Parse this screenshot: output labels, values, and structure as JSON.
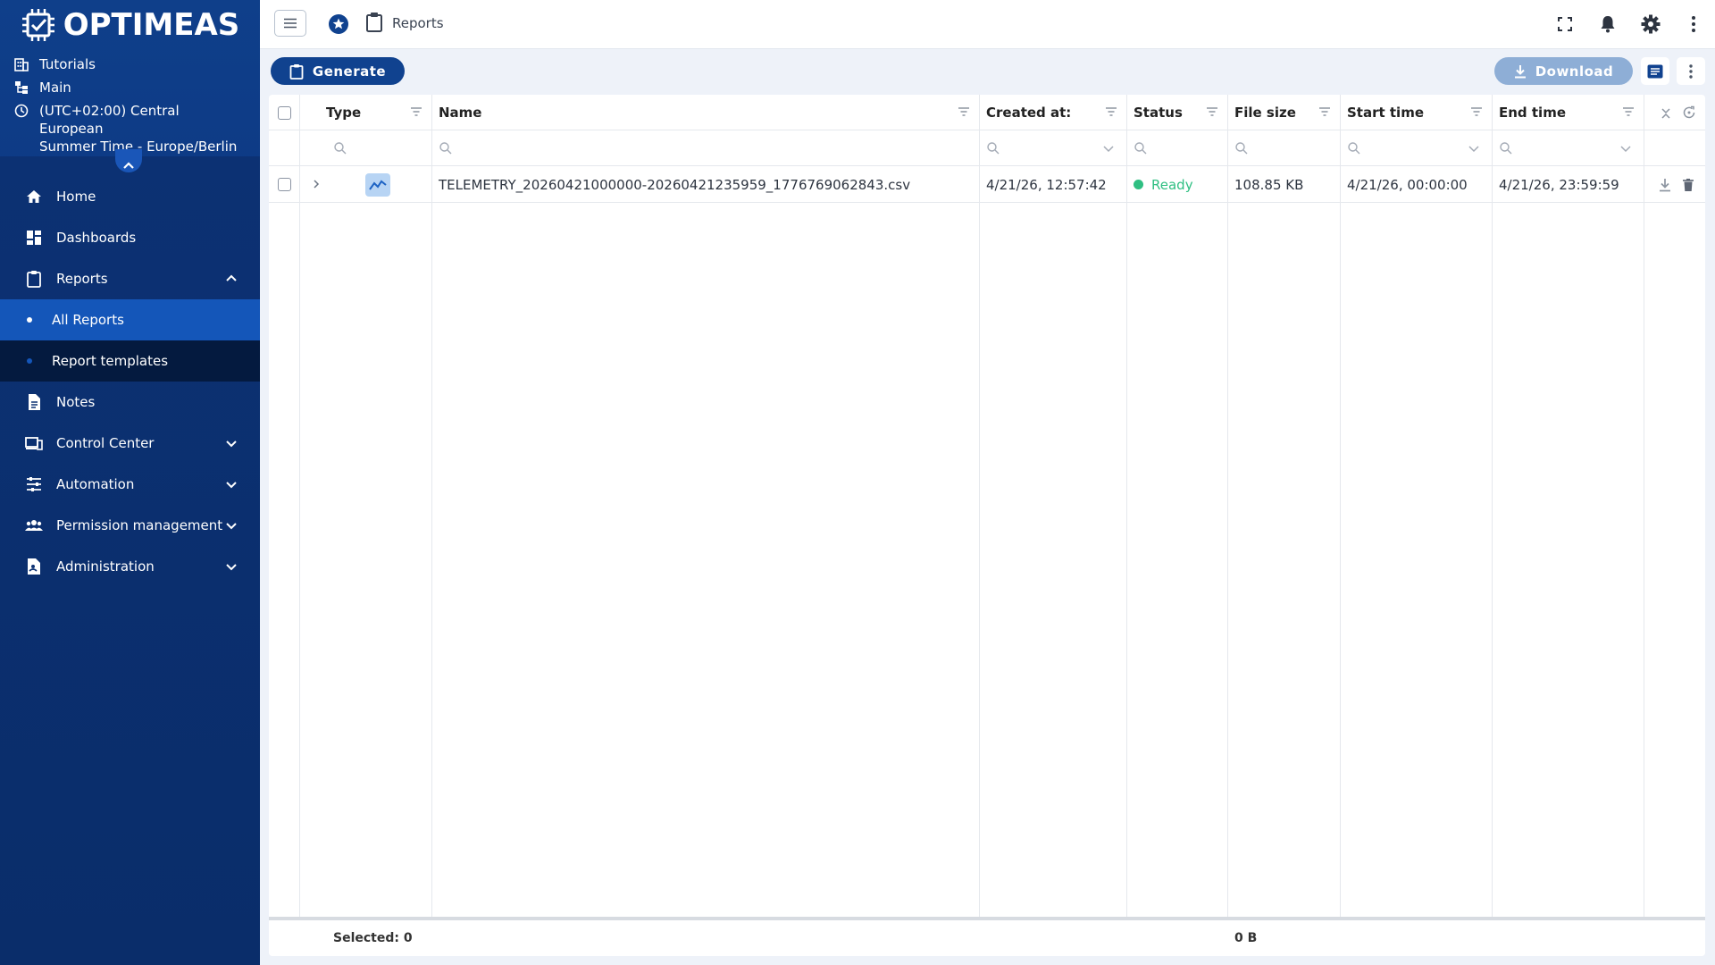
{
  "brand": {
    "name": "OPTIMEAS"
  },
  "meta": {
    "tutorials": "Tutorials",
    "main": "Main",
    "timezone_line1": "(UTC+02:00) Central European",
    "timezone_line2": "Summer Time - Europe/Berlin"
  },
  "nav": {
    "home": "Home",
    "dashboards": "Dashboards",
    "reports": "Reports",
    "all_reports": "All Reports",
    "report_templates": "Report templates",
    "notes": "Notes",
    "control_center": "Control Center",
    "automation": "Automation",
    "permission_management": "Permission management",
    "administration": "Administration"
  },
  "topbar": {
    "breadcrumb": "Reports"
  },
  "toolbar": {
    "generate_label": "Generate",
    "download_label": "Download"
  },
  "grid": {
    "columns": {
      "type": "Type",
      "name": "Name",
      "created_at": "Created at:",
      "status": "Status",
      "file_size": "File size",
      "start_time": "Start time",
      "end_time": "End time"
    },
    "rows": [
      {
        "name": "TELEMETRY_20260421000000-20260421235959_1776769062843.csv",
        "created_at": "4/21/26, 12:57:42",
        "status": "Ready",
        "file_size": "108.85 KB",
        "start_time": "4/21/26, 00:00:00",
        "end_time": "4/21/26, 23:59:59"
      }
    ],
    "footer": {
      "selected": "Selected: 0",
      "total_size": "0 B"
    }
  },
  "colors": {
    "sidebar": "#0c3173",
    "accent": "#1456b9",
    "ready": "#2fbf82",
    "primary_button": "#10428f"
  }
}
